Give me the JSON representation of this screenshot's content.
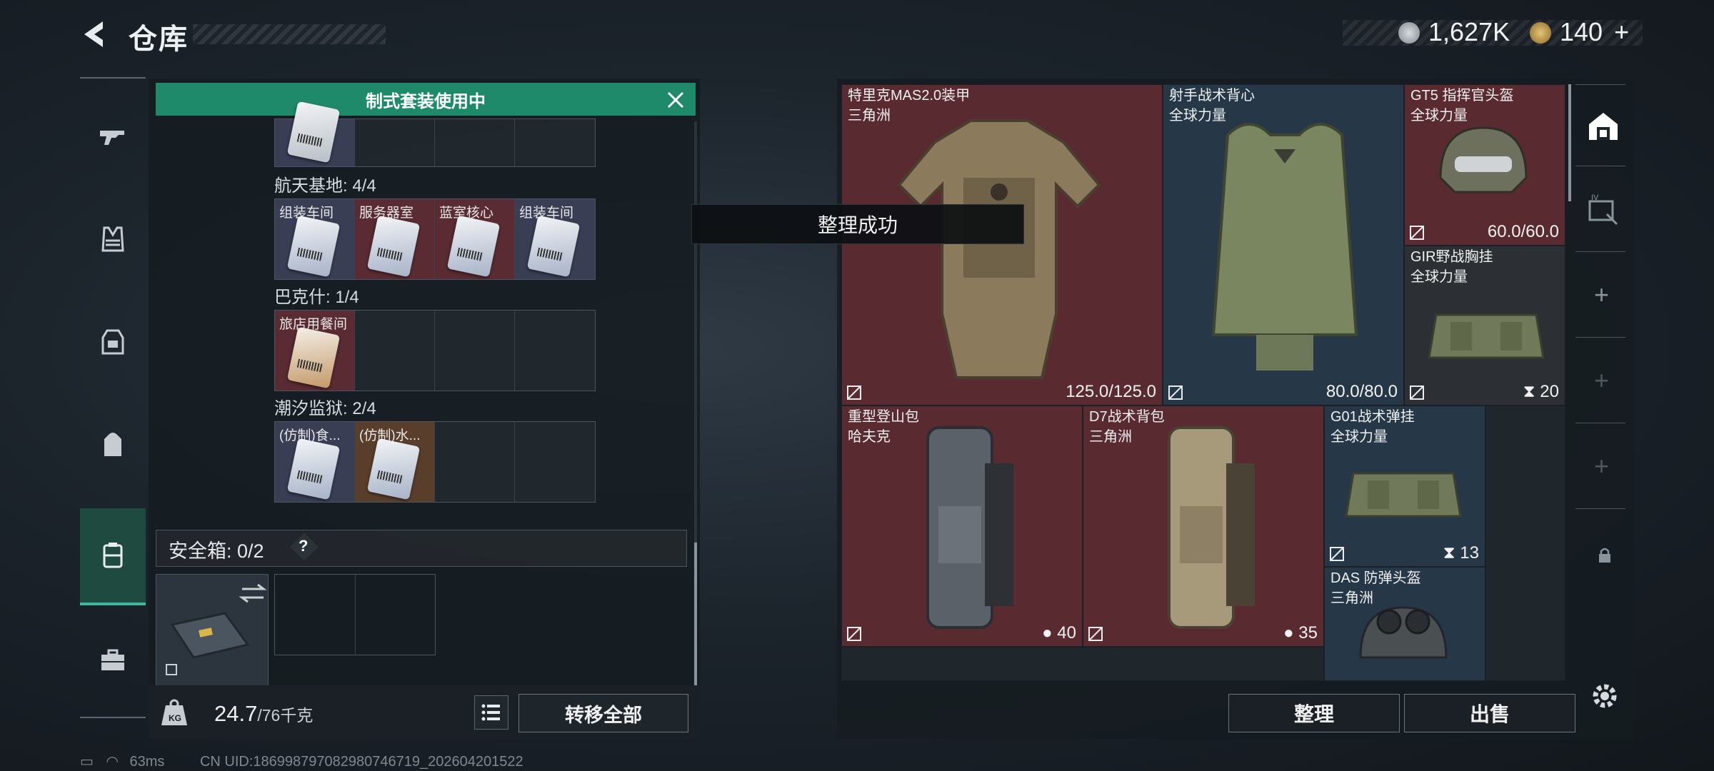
{
  "header": {
    "title": "仓库",
    "currency1": "1,627K",
    "currency2": "140",
    "plus": "+"
  },
  "banner": {
    "text": "制式套装使用中"
  },
  "groups": [
    {
      "title": "航天基地: 4/4",
      "cells": [
        {
          "label": "组装车间",
          "tone": "blue"
        },
        {
          "label": "服务器室",
          "tone": "red"
        },
        {
          "label": "蓝室核心",
          "tone": "red"
        },
        {
          "label": "组装车间",
          "tone": "blue"
        }
      ]
    },
    {
      "title": "巴克什: 1/4",
      "cells": [
        {
          "label": "旅店用餐间",
          "tone": "red"
        }
      ]
    },
    {
      "title": "潮汐监狱: 2/4",
      "cells": [
        {
          "label": "(仿制)食...",
          "tone": "blue"
        },
        {
          "label": "(仿制)水...",
          "tone": "orange"
        }
      ]
    }
  ],
  "safebox": {
    "label": "安全箱: 0/2",
    "help": "?"
  },
  "footer": {
    "weight": "24.7",
    "capacity": "/76千克",
    "transfer_label": "转移全部"
  },
  "toast": "整理成功",
  "storage": {
    "items": [
      {
        "name": "特里克MAS2.0装甲",
        "origin": "三角洲",
        "value": "125.0/125.0"
      },
      {
        "name": "射手战术背心",
        "origin": "全球力量",
        "value": "80.0/80.0"
      },
      {
        "name": "GT5 指挥官头盔",
        "origin": "全球力量",
        "value": "60.0/60.0"
      },
      {
        "name": "GIR野战胸挂",
        "origin": "全球力量",
        "value": "20"
      },
      {
        "name": "重型登山包",
        "origin": "哈夫克",
        "value": "40"
      },
      {
        "name": "D7战术背包",
        "origin": "三角洲",
        "value": "35"
      },
      {
        "name": "G01战术弹挂",
        "origin": "全球力量",
        "value": "13"
      },
      {
        "name": "DAS 防弹头盔",
        "origin": "三角洲",
        "value": ""
      }
    ]
  },
  "buttons": {
    "sort": "整理",
    "sell": "出售"
  },
  "status": {
    "ping": "63ms",
    "uid": "CN UID:186998797082980746719_202604201522"
  }
}
